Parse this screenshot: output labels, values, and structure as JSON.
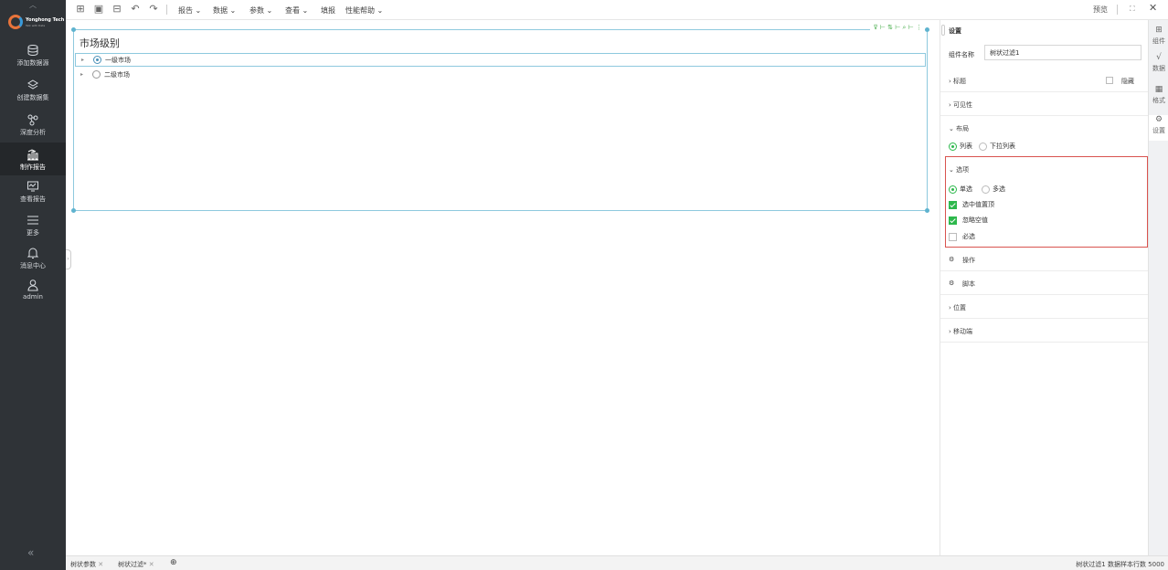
{
  "nav": {
    "logo_name": "Yonghong Tech",
    "logo_sub": "Talk with Data",
    "items": [
      {
        "label": "添加数据源",
        "icon": "database-icon"
      },
      {
        "label": "创建数据集",
        "icon": "layers-icon"
      },
      {
        "label": "深度分析",
        "icon": "analysis-icon"
      },
      {
        "label": "制作报告",
        "icon": "report-chart-icon"
      },
      {
        "label": "查看报告",
        "icon": "monitor-icon"
      },
      {
        "label": "更多",
        "icon": "menu-icon"
      },
      {
        "label": "消息中心",
        "icon": "bell-icon"
      },
      {
        "label": "admin",
        "icon": "user-icon"
      }
    ],
    "collapse": "«"
  },
  "toolbar": {
    "menus": [
      "报告 ⌄",
      "数据 ⌄",
      "参数 ⌄",
      "查看 ⌄",
      "填报",
      "性能帮助 ⌄"
    ],
    "preview": "预览"
  },
  "canvas": {
    "component_title": "市场级别",
    "tools": "⊽ ⊢ ⇅ ⊢ ⌕ ⊢ ⋮",
    "options": [
      {
        "label": "一级市场",
        "selected": true
      },
      {
        "label": "二级市场",
        "selected": false
      }
    ]
  },
  "panel": {
    "title": "设置",
    "name_label": "组件名称",
    "name_value": "树状过滤1",
    "sections": {
      "title": "› 标题",
      "hide": "隐藏",
      "visibility": "› 可见性",
      "layout": "⌄ 布局",
      "options": "⌄ 选项",
      "operation": "操作",
      "script": "脚本",
      "position": "› 位置",
      "mobile": "› 移动端"
    },
    "layout_list": "列表",
    "layout_dropdown": "下拉列表",
    "single": "单选",
    "multi": "多选",
    "select_first": "选中值置顶",
    "ignore_null": "忽略空值",
    "required": "必选"
  },
  "vtabs": [
    {
      "label": "组件",
      "icon": "component-icon"
    },
    {
      "label": "数据",
      "icon": "data-icon"
    },
    {
      "label": "格式",
      "icon": "format-icon"
    },
    {
      "label": "设置",
      "icon": "gear-icon"
    }
  ],
  "bottom": {
    "tab1": "树状参数",
    "tab2": "树状过滤*",
    "status": "树状过滤1  数据样本行数 5000"
  },
  "colors": {
    "accent_green": "#2db84c",
    "selection_blue": "#8ec9de",
    "highlight_red": "#d9534f",
    "nav_bg": "#2f3337"
  }
}
